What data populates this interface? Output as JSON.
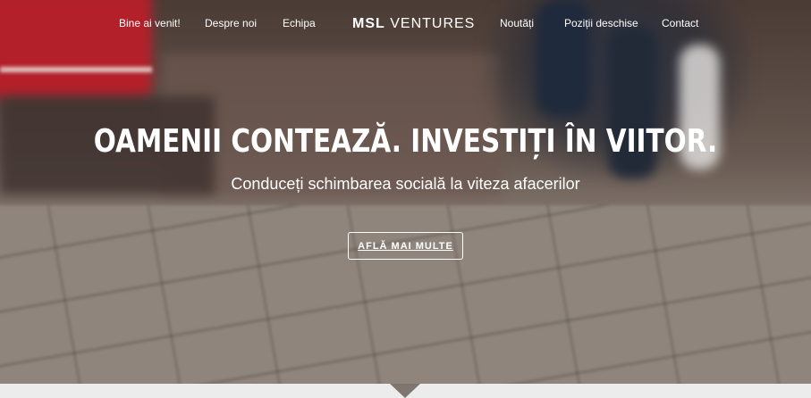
{
  "nav": {
    "items": [
      {
        "label": "Bine ai venit!"
      },
      {
        "label": "Despre noi"
      },
      {
        "label": "Echipa"
      },
      {
        "label": "Noutăți"
      },
      {
        "label": "Poziții deschise"
      },
      {
        "label": "Contact"
      }
    ],
    "brand_bold": "MSL",
    "brand_rest": " VENTURES"
  },
  "hero": {
    "headline": "OAMENII CONTEAZĂ. INVESTIȚI ÎN VIITOR.",
    "subheadline": "Conduceți schimbarea socială la viteza afacerilor",
    "cta_label": "AFLĂ MAI MULTE"
  },
  "colors": {
    "text": "#ffffff",
    "footer_band": "#ececec"
  },
  "icons": {
    "scroll_indicator": "down-arrow-icon"
  }
}
